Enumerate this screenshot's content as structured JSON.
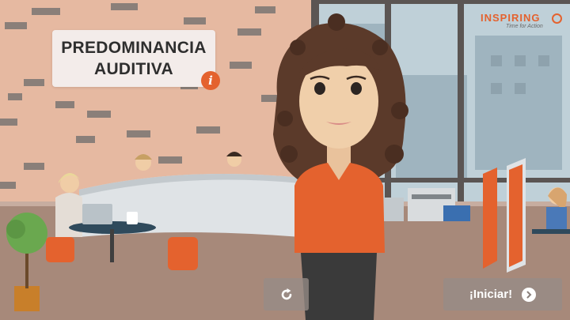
{
  "title_card": {
    "line1": "PREDOMINANCIA",
    "line2": "AUDITIVA"
  },
  "info_button": {
    "icon": "info-icon",
    "glyph": "i"
  },
  "logo": {
    "word": "INSPIRING",
    "tagline": "Time for Action"
  },
  "controls": {
    "replay": {
      "icon": "replay-icon"
    },
    "start": {
      "label": "¡Iniciar!",
      "icon": "chevron-right-icon"
    }
  },
  "colors": {
    "accent": "#e4622e",
    "brick_wall": "#e6b9a1",
    "button_bg": "#968c87",
    "title_text": "#2e2e2e"
  }
}
